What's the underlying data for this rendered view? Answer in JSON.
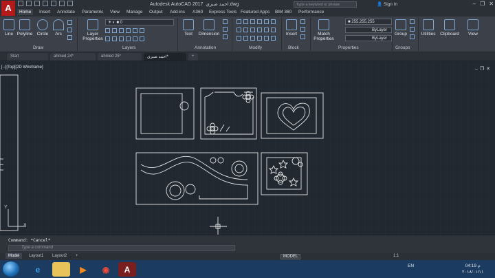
{
  "title_bar": {
    "app_title": "Autodesk AutoCAD 2017",
    "file_name": "احمد صبري.dwg",
    "search_placeholder": "Type a keyword or phrase",
    "sign_in": "Sign In"
  },
  "ribbon_tabs": [
    "Home",
    "Insert",
    "Annotate",
    "Parametric",
    "View",
    "Manage",
    "Output",
    "Add-ins",
    "A360",
    "Express Tools",
    "Featured Apps",
    "BIM 360",
    "Performance"
  ],
  "ribbon": {
    "draw_tools": [
      "Line",
      "Polyline",
      "Circle",
      "Arc"
    ],
    "layer_properties": "Layer Properties",
    "layer_value": "0",
    "annotation_tools": [
      "Text",
      "Dimension"
    ],
    "block_insert": "Insert",
    "match_properties": "Match Properties",
    "color_value": "255,255,255",
    "linetype_value": "ByLayer",
    "lineweight_value": "ByLayer",
    "group": "Group",
    "utilities": "Utilities",
    "clipboard": "Clipboard",
    "view": "View",
    "panels": [
      "Draw",
      "Modify",
      "Layers",
      "Annotation",
      "Block",
      "Properties",
      "Groups"
    ]
  },
  "doc_tabs": [
    "Start",
    "ahmed 24*",
    "ahmed 25*",
    "احمد صبري*"
  ],
  "viewport": {
    "label": "[--][Top][2D Wireframe]"
  },
  "command": {
    "history": "Command: *Cancel*",
    "placeholder": "Type a command"
  },
  "layout_tabs": [
    "Model",
    "Layout1",
    "Layout2"
  ],
  "status": {
    "model_button": "MODEL",
    "scale": "1:1"
  },
  "taskbar": {
    "language": "EN",
    "time": "04:19 م",
    "date": "٢٠١٨/٠١/١١"
  },
  "colors": {
    "ribbon_bg": "#3b4049",
    "viewport_bg": "#212830",
    "taskbar_bg": "#1b3b61",
    "autocad_red": "#b31b1b"
  }
}
